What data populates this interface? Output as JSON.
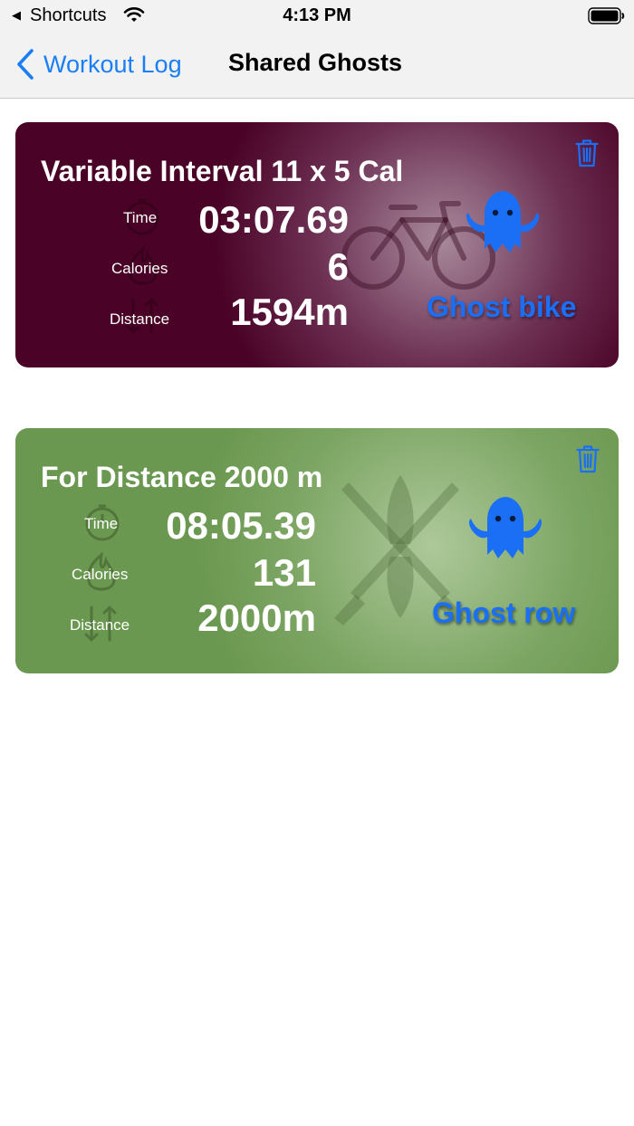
{
  "status_bar": {
    "back_glyph": "◀",
    "app": "Shortcuts",
    "time": "4:13 PM"
  },
  "nav": {
    "back_label": "Workout Log",
    "title": "Shared Ghosts"
  },
  "cards": [
    {
      "title": "Variable Interval  11 x 5 Cal",
      "stats": [
        {
          "label": "Time",
          "value": "03:07.69"
        },
        {
          "label": "Calories",
          "value": "6"
        },
        {
          "label": "Distance",
          "value": "1594m"
        }
      ],
      "ghost_label": "Ghost bike",
      "background": "#4a0326",
      "watermark": "bike-icon"
    },
    {
      "title": "For Distance  2000 m",
      "stats": [
        {
          "label": "Time",
          "value": "08:05.39"
        },
        {
          "label": "Calories",
          "value": "131"
        },
        {
          "label": "Distance",
          "value": "2000m"
        }
      ],
      "ghost_label": "Ghost row",
      "background": "#6b9850",
      "watermark": "crossed-oars-icon"
    }
  ],
  "colors": {
    "accent": "#1a7ef5",
    "ghost": "#1a6ff5"
  }
}
